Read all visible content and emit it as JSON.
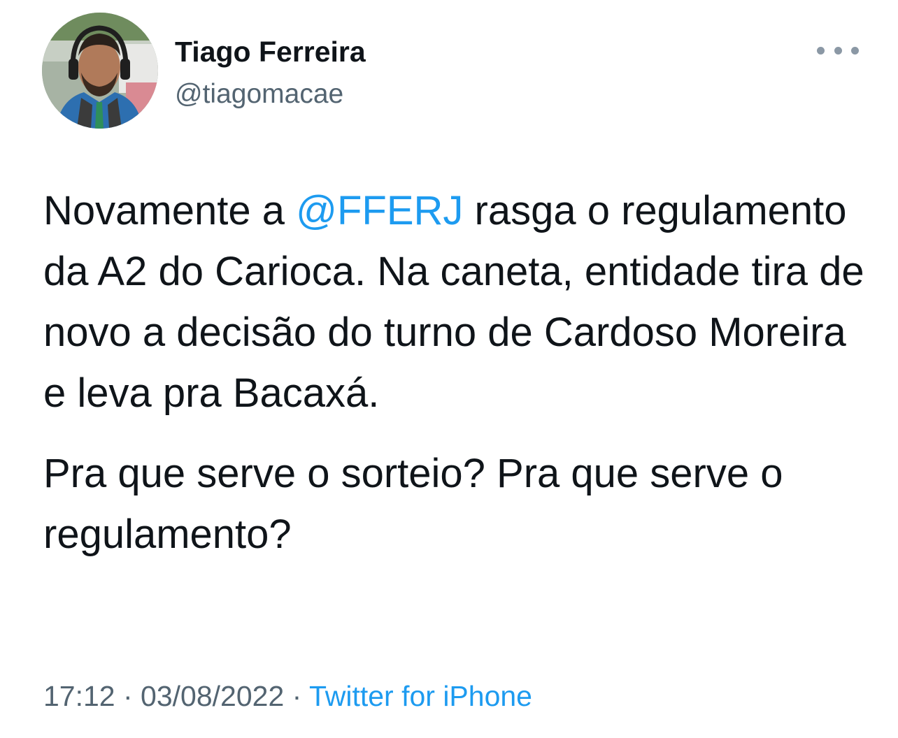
{
  "author": {
    "name": "Tiago Ferreira",
    "handle": "@tiagomacae",
    "avatar_icon": "profile-photo"
  },
  "more_icon": "ellipsis-horizontal-icon",
  "tweet": {
    "paragraph1": {
      "before_mention": "Novamente a ",
      "mention": "@FFERJ",
      "after_mention": " rasga o regulamento da A2 do Carioca. Na caneta, entidade tira de novo a decisão do turno de Cardoso Moreira e leva pra Bacaxá."
    },
    "paragraph2": "Pra que serve o sorteio? Pra que serve o regulamento?"
  },
  "meta": {
    "time": "17:12",
    "separator": " · ",
    "date": "03/08/2022",
    "source": "Twitter for iPhone"
  },
  "colors": {
    "link": "#1d9bf0",
    "text": "#0f1419",
    "secondary": "#536471"
  }
}
